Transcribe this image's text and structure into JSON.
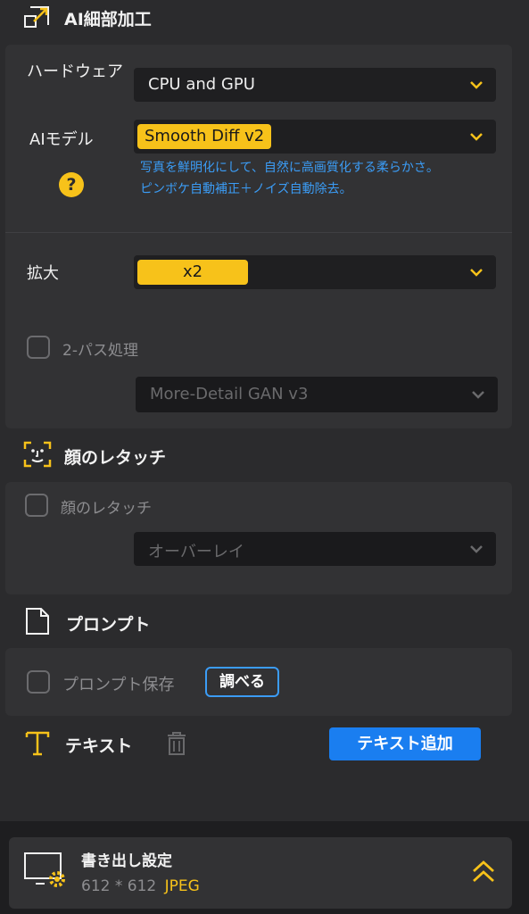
{
  "ai_section": {
    "title": "AI細部加工",
    "hardware_label": "ハードウェア",
    "hardware_value": "CPU and GPU",
    "model_label": "AIモデル",
    "model_value": "Smooth Diff v2",
    "model_desc_line1": "写真を鮮明化にして、自然に高画質化する柔らかさ。",
    "model_desc_line2": "ピンボケ自動補正＋ノイズ自動除去。",
    "help_glyph": "?",
    "scale_label": "拡大",
    "scale_value": "x2",
    "twopass_label": "2-パス処理",
    "twopass_model": "More-Detail GAN v3"
  },
  "face_section": {
    "title": "顔のレタッチ",
    "checkbox_label": "顔のレタッチ",
    "mode_value": "オーバーレイ"
  },
  "prompt_section": {
    "title": "プロンプト",
    "save_label": "プロンプト保存",
    "check_button": "調べる"
  },
  "text_section": {
    "title": "テキスト",
    "add_button": "テキスト追加"
  },
  "export": {
    "title": "書き出し設定",
    "size": "612 * 612",
    "format": "JPEG"
  },
  "colors": {
    "accent_yellow": "#f7c21a",
    "accent_blue": "#1a7ef0",
    "link_blue": "#3b9cf5"
  }
}
